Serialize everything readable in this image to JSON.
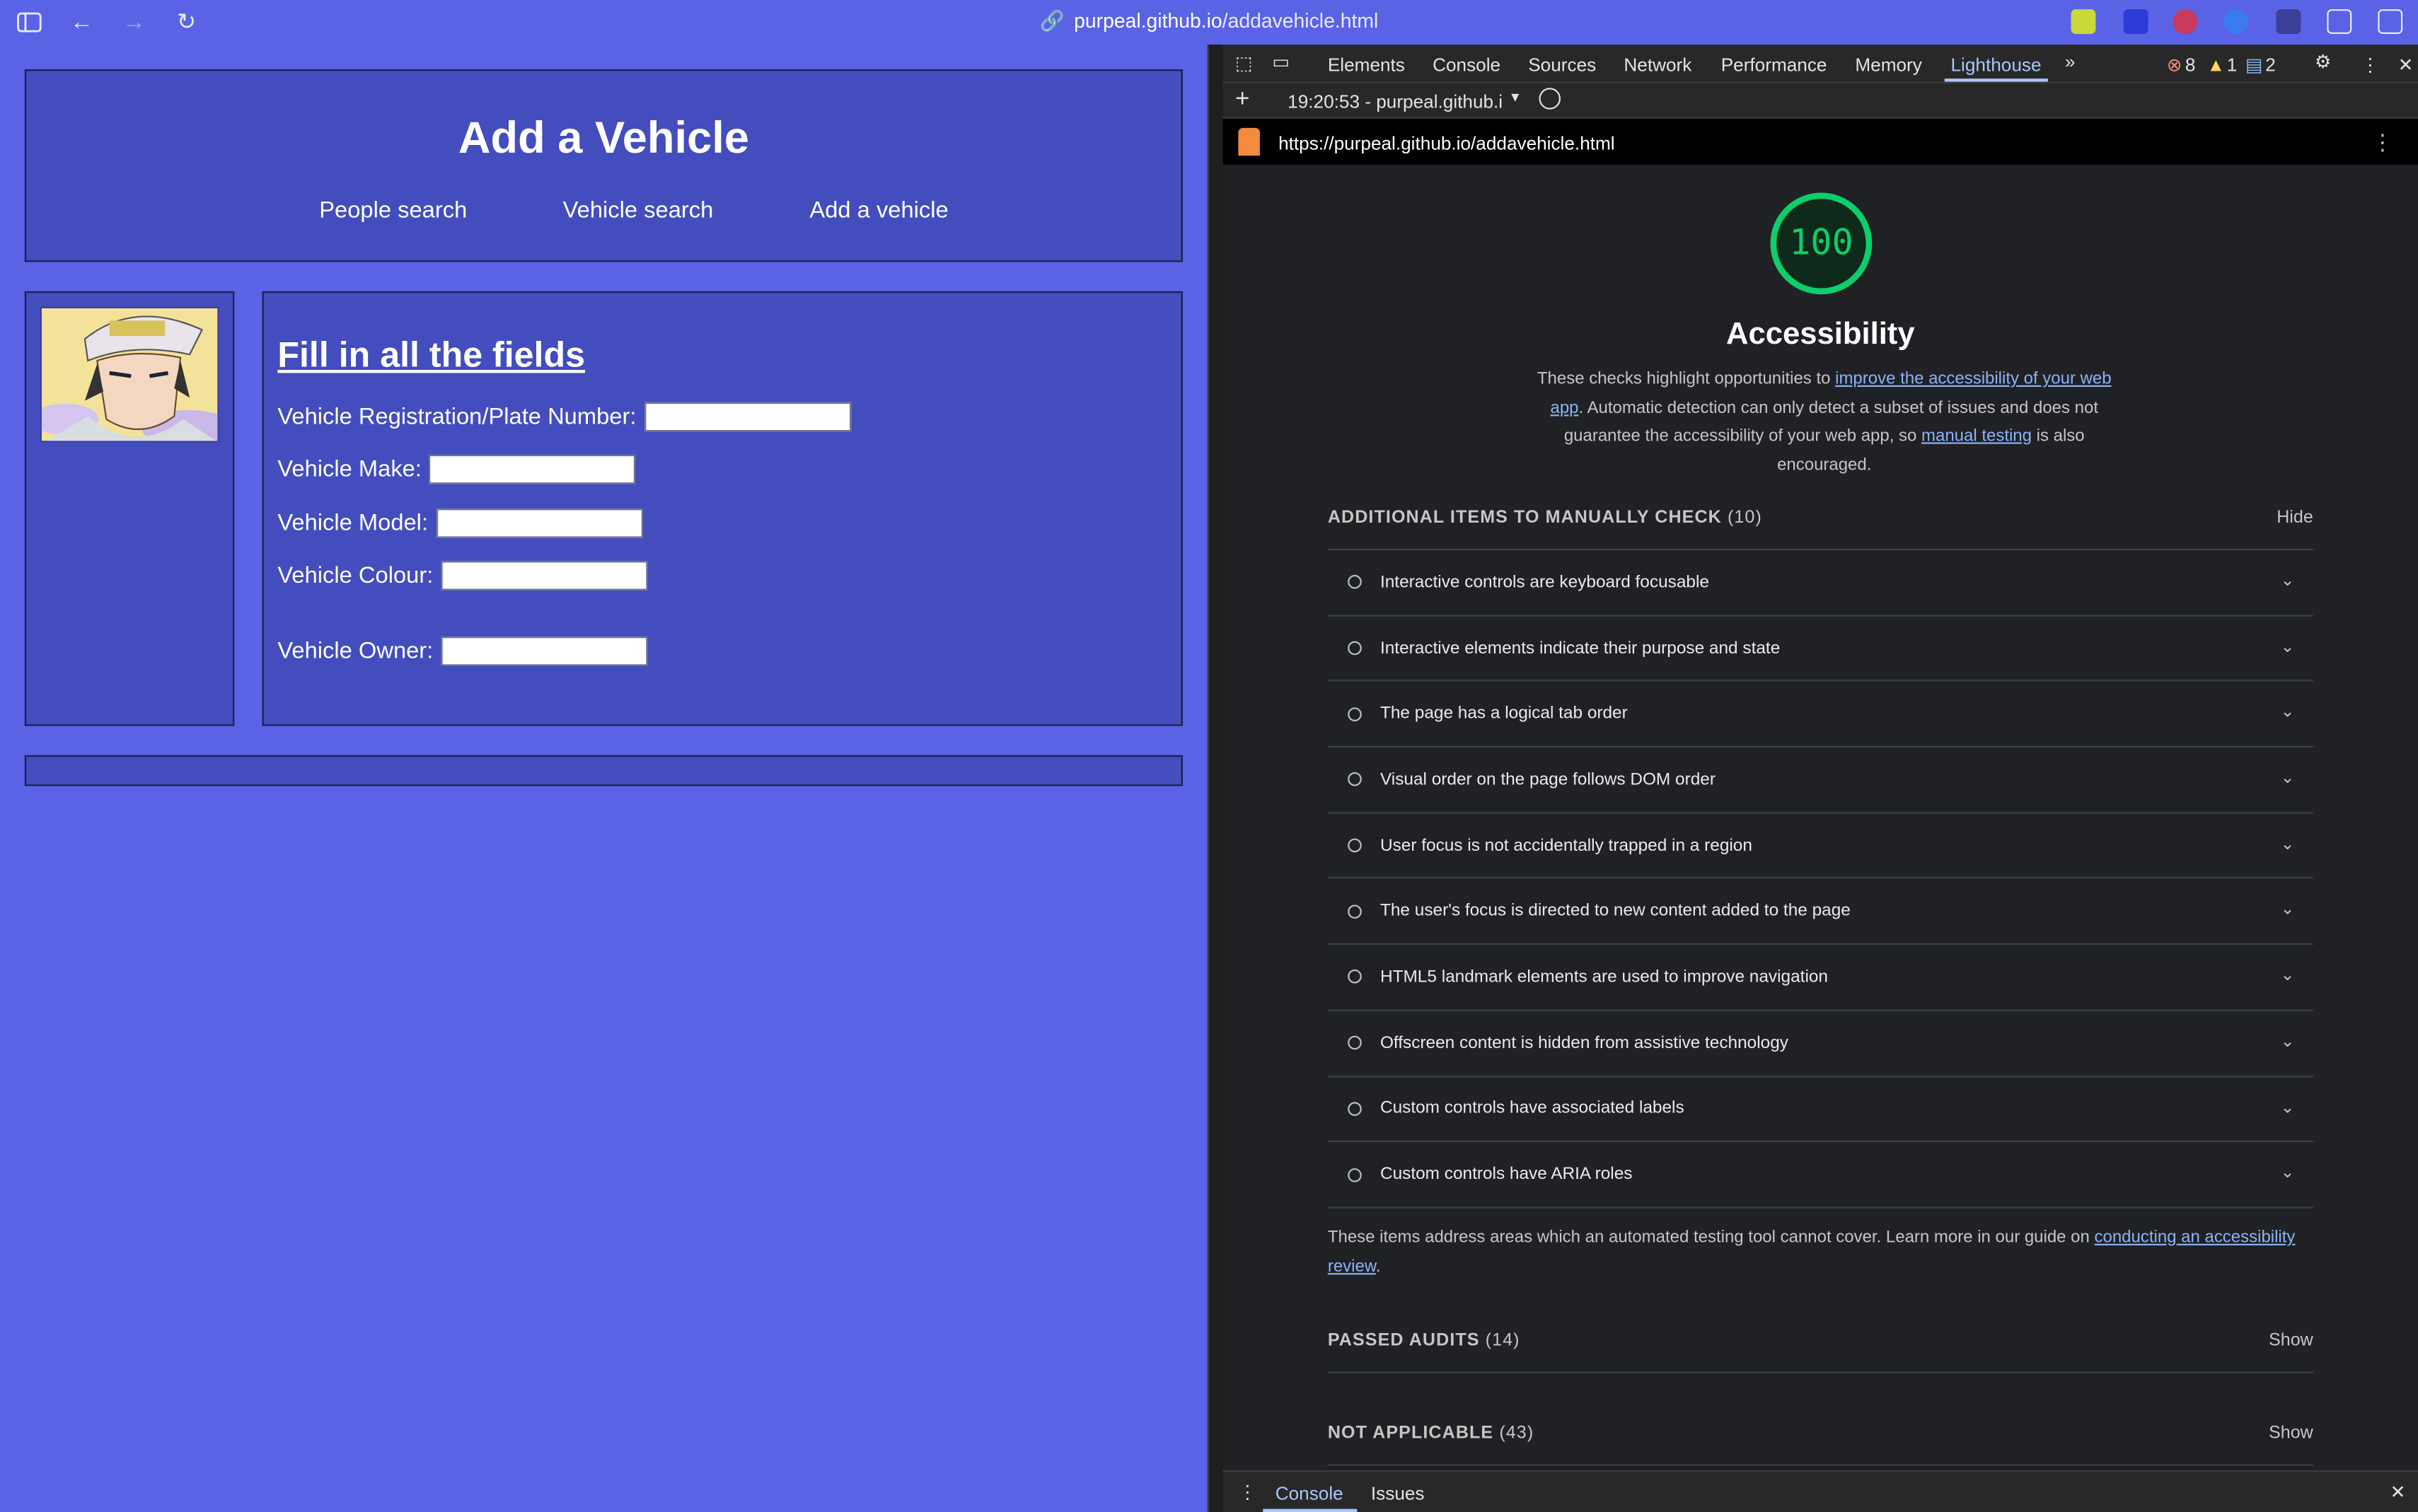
{
  "browser": {
    "url_host": "purpeal.github.io",
    "url_path": "/addavehicle.html"
  },
  "site": {
    "title": "Add a Vehicle",
    "nav": [
      "People search",
      "Vehicle search",
      "Add a vehicle"
    ],
    "form": {
      "title": "Fill in all the fields",
      "fields": [
        {
          "label": "Vehicle Registration/Plate Number:",
          "value": ""
        },
        {
          "label": "Vehicle Make:",
          "value": ""
        },
        {
          "label": "Vehicle Model:",
          "value": ""
        },
        {
          "label": "Vehicle Colour:",
          "value": ""
        },
        {
          "label": "Vehicle Owner:",
          "value": ""
        }
      ]
    }
  },
  "devtools": {
    "tabs": [
      "Elements",
      "Console",
      "Sources",
      "Network",
      "Performance",
      "Memory",
      "Lighthouse"
    ],
    "active_tab": "Lighthouse",
    "errors": "8",
    "warnings": "1",
    "messages": "2",
    "report_selector": "19:20:53 - purpeal.github.i",
    "report_url": "https://purpeal.github.io/addavehicle.html",
    "score": "100",
    "category": "Accessibility",
    "desc_1": "These checks highlight opportunities to ",
    "desc_link_1": "improve the accessibility of your web app",
    "desc_2": ". Automatic detection can only detect a subset of issues and does not guarantee the accessibility of your web app, so ",
    "desc_link_2": "manual testing",
    "desc_3": " is also encouraged.",
    "manual_section": {
      "title": "ADDITIONAL ITEMS TO MANUALLY CHECK",
      "count": "(10)",
      "action": "Hide"
    },
    "manual_items": [
      "Interactive controls are keyboard focusable",
      "Interactive elements indicate their purpose and state",
      "The page has a logical tab order",
      "Visual order on the page follows DOM order",
      "User focus is not accidentally trapped in a region",
      "The user's focus is directed to new content added to the page",
      "HTML5 landmark elements are used to improve navigation",
      "Offscreen content is hidden from assistive technology",
      "Custom controls have associated labels",
      "Custom controls have ARIA roles"
    ],
    "note_1": "These items address areas which an automated testing tool cannot cover. Learn more in our guide on ",
    "note_link": "conducting an accessibility review",
    "note_2": ".",
    "passed": {
      "title": "PASSED AUDITS",
      "count": "(14)",
      "action": "Show"
    },
    "na": {
      "title": "NOT APPLICABLE",
      "count": "(43)",
      "action": "Show"
    },
    "drawer_tabs": [
      "Console",
      "Issues"
    ]
  },
  "colors": {
    "page_bg": "#5a63e6",
    "panel_bg": "#434dbe",
    "score_green": "#0cce6b",
    "devtools_accent": "#a8c7fa"
  }
}
